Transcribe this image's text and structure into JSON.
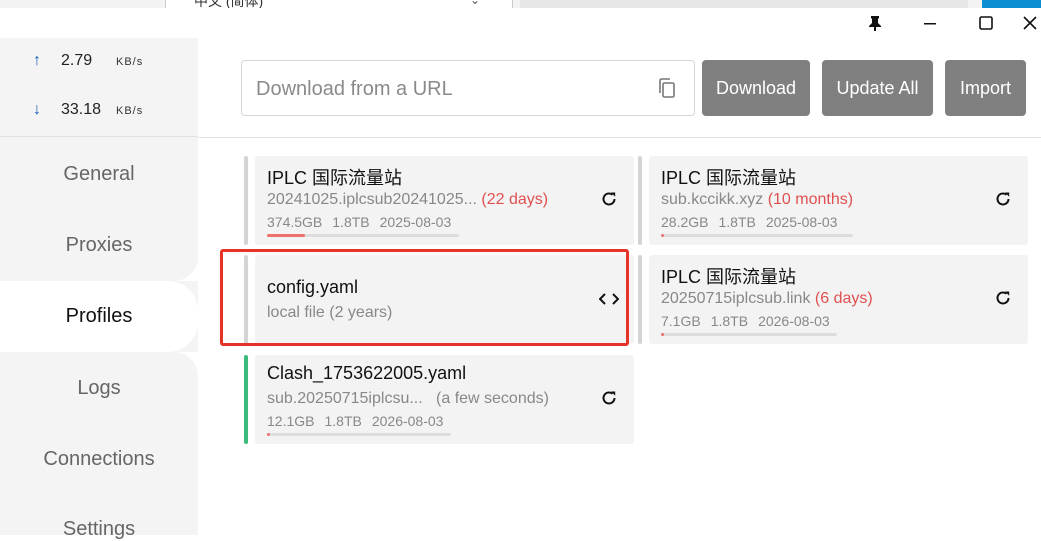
{
  "background_window": {
    "language_select": "中文 (简体)"
  },
  "sidebar": {
    "traffic": {
      "upload_value": "2.79",
      "upload_unit": "KB/s",
      "download_value": "33.18",
      "download_unit": "KB/s"
    },
    "nav": [
      {
        "label": "General"
      },
      {
        "label": "Proxies"
      },
      {
        "label": "Profiles"
      },
      {
        "label": "Logs"
      },
      {
        "label": "Connections"
      },
      {
        "label": "Settings"
      }
    ],
    "active": "Profiles"
  },
  "toolbar": {
    "url_placeholder": "Download from a URL",
    "download_label": "Download",
    "update_all_label": "Update All",
    "import_label": "Import"
  },
  "profiles": [
    {
      "title": "IPLC 国际流量站",
      "source": "20241025.iplcsub20241025...",
      "updated": "(22 days)",
      "used": "374.5GB",
      "total": "1.8TB",
      "expire": "2025-08-03",
      "usage_fraction": 0.2,
      "active": false
    },
    {
      "title": "IPLC 国际流量站",
      "source": "sub.kccikk.xyz",
      "updated": "(10 months)",
      "used": "28.2GB",
      "total": "1.8TB",
      "expire": "2025-08-03",
      "usage_fraction": 0.015,
      "active": false
    },
    {
      "title": "config.yaml",
      "source": "local file (2 years)",
      "active": false
    },
    {
      "title": "IPLC 国际流量站",
      "source": "20250715iplcsub.link",
      "updated": "(6 days)",
      "used": "7.1GB",
      "total": "1.8TB",
      "expire": "2026-08-03",
      "usage_fraction": 0.004,
      "active": false
    },
    {
      "title": "Clash_1753622005.yaml",
      "source": "sub.20250715iplcsu...",
      "updated": "(a few seconds)",
      "used": "12.1GB",
      "total": "1.8TB",
      "expire": "2026-08-03",
      "usage_fraction": 0.007,
      "active": true
    }
  ],
  "colors": {
    "accent_active": "#3cba7c",
    "warning_red": "#e05050",
    "highlight_border": "#e5332a",
    "button_gray": "#808080"
  }
}
